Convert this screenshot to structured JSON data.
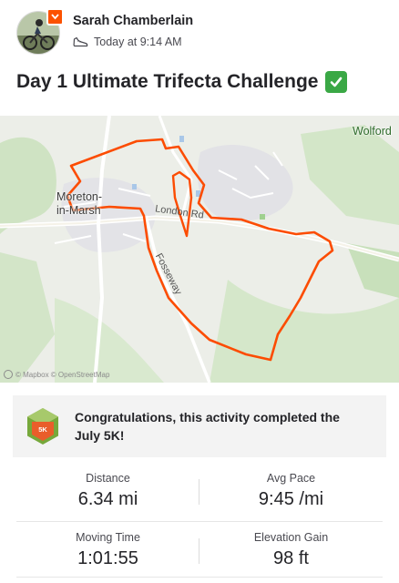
{
  "athlete": {
    "name": "Sarah Chamberlain",
    "timestamp": "Today at 9:14 AM",
    "activity_icon": "shoe-icon"
  },
  "activity": {
    "title": "Day 1 Ultimate Trifecta Challenge",
    "title_emoji": "check-mark-icon"
  },
  "map": {
    "places": {
      "town_line1": "Moreton-",
      "town_line2": "in-Marsh",
      "village": "Wolford"
    },
    "roads": {
      "london_rd": "London Rd",
      "road_b": "Fosseway"
    },
    "attribution": "© Mapbox © OpenStreetMap",
    "route_color": "#fc4c02"
  },
  "achievement": {
    "badge_label": "5K",
    "text": "Congratulations, this activity completed the July 5K!"
  },
  "stats": {
    "distance_label": "Distance",
    "distance_value": "6.34 mi",
    "pace_label": "Avg Pace",
    "pace_value": "9:45 /mi",
    "moving_time_label": "Moving Time",
    "moving_time_value": "1:01:55",
    "elevation_label": "Elevation Gain",
    "elevation_value": "98 ft"
  },
  "colors": {
    "brand": "#fc5200",
    "text": "#242428",
    "secondary_text": "#494950"
  }
}
